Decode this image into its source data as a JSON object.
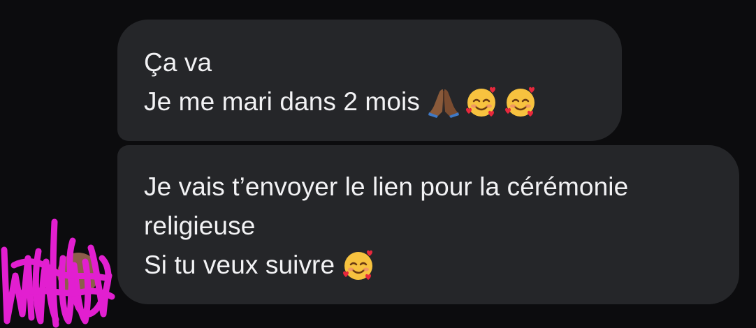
{
  "conversation": {
    "messages": [
      {
        "lines": [
          "Ça va",
          "Je me mari dans 2 mois"
        ],
        "emojis": [
          "folded-hands-icon",
          "smiling-face-with-hearts-icon",
          "smiling-face-with-hearts-icon"
        ]
      },
      {
        "lines": [
          "Je vais t’envoyer le lien pour la cérémonie",
          "religieuse",
          "Si tu veux suivre"
        ],
        "emojis": [
          "smiling-face-with-hearts-icon"
        ]
      }
    ]
  },
  "colors": {
    "background": "#0c0c0e",
    "bubble": "#252629",
    "text": "#f2f2f4",
    "scribble": "#e21fd0"
  },
  "avatar": {
    "state": "obscured-by-scribble"
  }
}
